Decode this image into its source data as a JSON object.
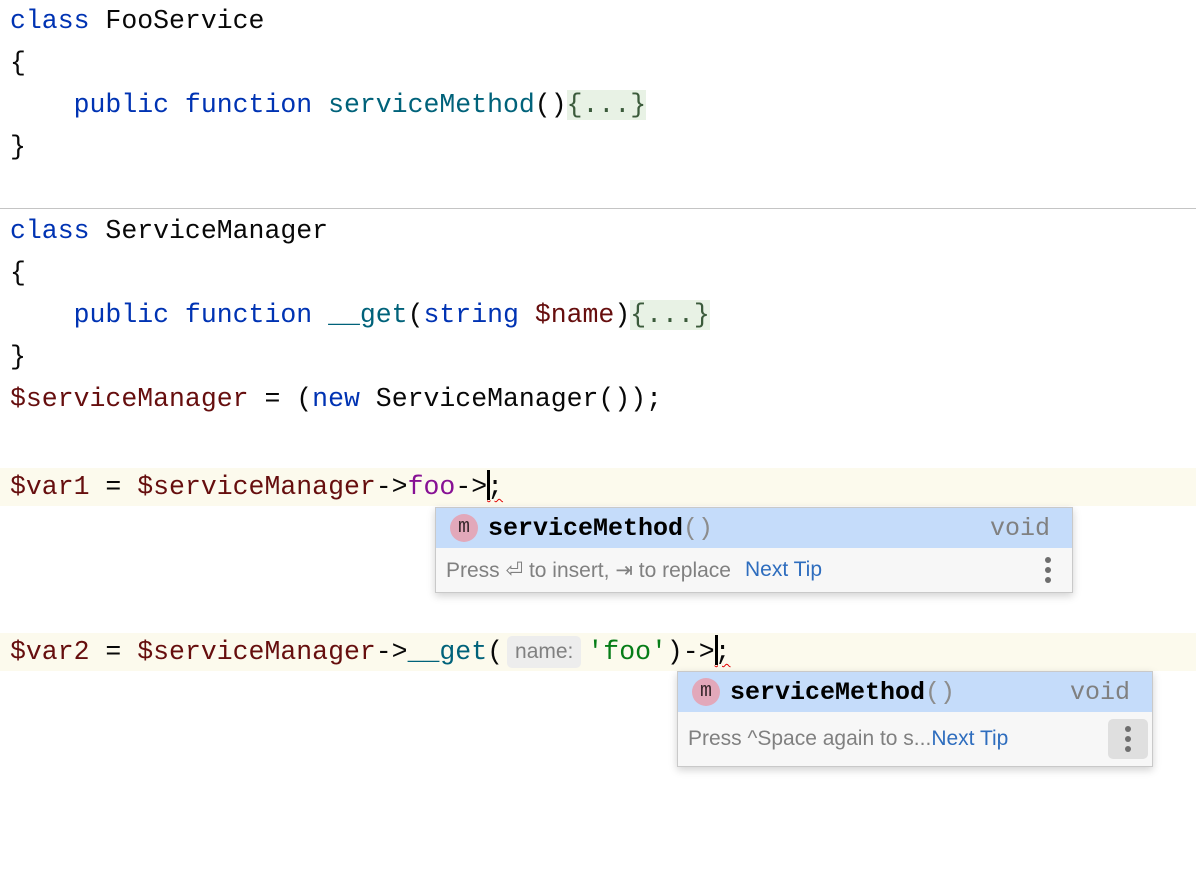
{
  "editor": {
    "lines": [
      [
        [
          "class ",
          "kw"
        ],
        [
          "FooService",
          ""
        ]
      ],
      [
        [
          "{",
          ""
        ]
      ],
      [
        [
          "    public function ",
          "kw"
        ],
        [
          "serviceMethod",
          "fn"
        ],
        [
          "()",
          ""
        ],
        [
          "{...}",
          "fold"
        ]
      ],
      [
        [
          "}",
          ""
        ]
      ],
      [],
      [
        [
          "class ",
          "kw"
        ],
        [
          "ServiceManager",
          ""
        ]
      ],
      [
        [
          "{",
          ""
        ]
      ],
      [
        [
          "    public function ",
          "kw"
        ],
        [
          "__get",
          "fn"
        ],
        [
          "(",
          ""
        ],
        [
          "string ",
          "kw"
        ],
        [
          "$name",
          "var"
        ],
        [
          ")",
          ""
        ],
        [
          "{...}",
          "fold"
        ]
      ],
      [
        [
          "}",
          ""
        ]
      ],
      [
        [
          "$serviceManager",
          "var"
        ],
        [
          " = (",
          ""
        ],
        [
          "new ",
          "kw"
        ],
        [
          "ServiceManager());",
          ""
        ]
      ]
    ],
    "var1_line": [
      [
        "$var1",
        "var"
      ],
      [
        " = ",
        ""
      ],
      [
        "$serviceManager",
        "var"
      ],
      [
        "->",
        ""
      ],
      [
        "foo",
        "fld"
      ],
      [
        "->",
        ""
      ]
    ],
    "var2_line_before_hint": [
      [
        "$var2",
        "var"
      ],
      [
        " = ",
        ""
      ],
      [
        "$serviceManager",
        "var"
      ],
      [
        "->",
        ""
      ],
      [
        "__get",
        "fn"
      ],
      [
        "(",
        ""
      ]
    ],
    "var2_hint": "name:",
    "var2_line_after_hint": [
      [
        "'foo'",
        "str"
      ],
      [
        ")->",
        ""
      ]
    ],
    "semicolon": ";"
  },
  "popup1": {
    "icon_letter": "m",
    "item_name": "serviceMethod",
    "item_params": "()",
    "item_type": "void",
    "footer_text": "Press ⏎ to insert, ⇥ to replace",
    "next_tip": "Next Tip"
  },
  "popup2": {
    "icon_letter": "m",
    "item_name": "serviceMethod",
    "item_params": "()",
    "item_type": "void",
    "footer_text": "Press ^Space again to s...",
    "next_tip": "Next Tip"
  },
  "colors": {
    "keyword": "#0033b3",
    "function": "#00627a",
    "variable": "#660e0e",
    "field": "#871094",
    "string": "#067d17",
    "selection": "#c5dcfa",
    "link": "#2e6dbe"
  }
}
